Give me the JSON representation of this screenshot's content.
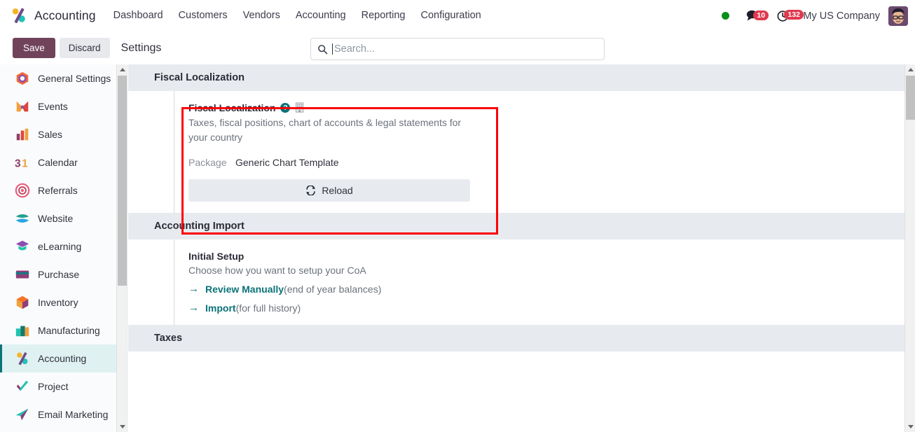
{
  "navbar": {
    "logo_icon": "accounting-app-logo",
    "brand": "Accounting",
    "menus": [
      {
        "label": "Dashboard"
      },
      {
        "label": "Customers"
      },
      {
        "label": "Vendors"
      },
      {
        "label": "Accounting"
      },
      {
        "label": "Reporting"
      },
      {
        "label": "Configuration"
      }
    ],
    "status_dot_color": "#0a8f18",
    "messages": {
      "icon": "messages-icon",
      "badge": "10"
    },
    "activities": {
      "icon": "clock-activities-icon",
      "badge": "132"
    },
    "company": "My US Company",
    "avatar_icon": "user-avatar"
  },
  "control_panel": {
    "save_label": "Save",
    "discard_label": "Discard",
    "breadcrumb": "Settings",
    "search": {
      "icon": "search-icon",
      "placeholder": "Search...",
      "value": ""
    }
  },
  "sidebar": {
    "items": [
      {
        "label": "General Settings",
        "icon": "general-settings-icon",
        "active": false
      },
      {
        "label": "Events",
        "icon": "events-icon",
        "active": false
      },
      {
        "label": "Sales",
        "icon": "sales-icon",
        "active": false
      },
      {
        "label": "Calendar",
        "icon": "calendar-icon",
        "active": false
      },
      {
        "label": "Referrals",
        "icon": "referrals-icon",
        "active": false
      },
      {
        "label": "Website",
        "icon": "website-icon",
        "active": false
      },
      {
        "label": "eLearning",
        "icon": "elearning-icon",
        "active": false
      },
      {
        "label": "Purchase",
        "icon": "purchase-icon",
        "active": false
      },
      {
        "label": "Inventory",
        "icon": "inventory-icon",
        "active": false
      },
      {
        "label": "Manufacturing",
        "icon": "manufacturing-icon",
        "active": false
      },
      {
        "label": "Accounting",
        "icon": "accounting-icon",
        "active": true
      },
      {
        "label": "Project",
        "icon": "project-icon",
        "active": false
      },
      {
        "label": "Email Marketing",
        "icon": "email-marketing-icon",
        "active": false
      }
    ]
  },
  "sections": {
    "fiscal_localization": {
      "header": "Fiscal Localization",
      "card": {
        "title": "Fiscal Localization",
        "help_icon": "help-question-icon",
        "company_icon": "building-icon",
        "description": "Taxes, fiscal positions, chart of accounts & legal statements for your country",
        "package_label": "Package",
        "package_value": "Generic Chart Template",
        "reload_label": "Reload",
        "reload_icon": "refresh-icon",
        "highlight_color": "#fb0007"
      }
    },
    "accounting_import": {
      "header": "Accounting Import",
      "setup": {
        "title": "Initial Setup",
        "description": "Choose how you want to setup your CoA",
        "links": [
          {
            "label": "Review Manually",
            "note": "(end of year balances)",
            "arrow": "→"
          },
          {
            "label": "Import",
            "note": "(for full history)",
            "arrow": "→"
          }
        ]
      }
    },
    "taxes": {
      "header": "Taxes"
    }
  }
}
